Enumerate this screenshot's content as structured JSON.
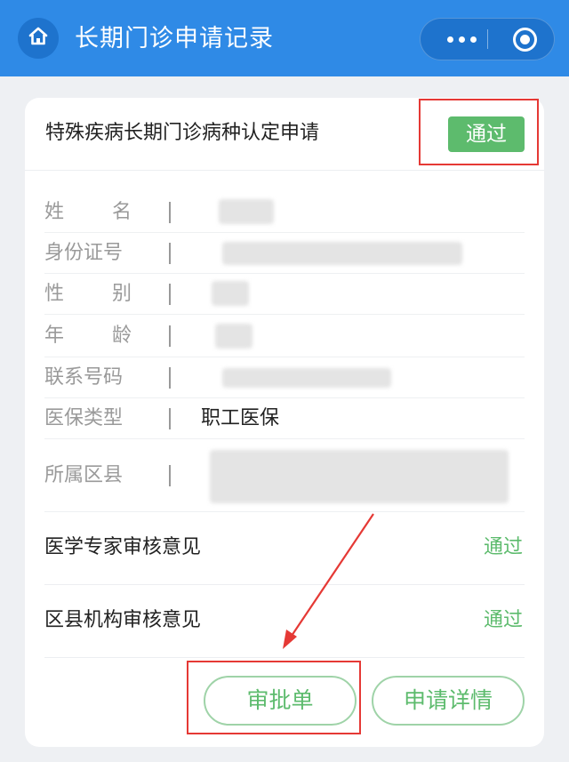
{
  "header": {
    "title": "长期门诊申请记录",
    "bg_color": "#2f8ae6"
  },
  "application": {
    "title": "特殊疾病长期门诊病种认定申请",
    "status": "通过",
    "status_color": "#5dbb6d"
  },
  "info": [
    {
      "label_chars": [
        "姓",
        "名"
      ],
      "value": ""
    },
    {
      "label": "身份证号",
      "value": ""
    },
    {
      "label_chars": [
        "性",
        "别"
      ],
      "value": ""
    },
    {
      "label_chars": [
        "年",
        "龄"
      ],
      "value": ""
    },
    {
      "label": "联系号码",
      "value": ""
    },
    {
      "label": "医保类型",
      "value": "职工医保"
    },
    {
      "label": "所属区县",
      "value": ""
    }
  ],
  "opinions": [
    {
      "label": "医学专家审核意见",
      "value": "通过"
    },
    {
      "label": "区县机构审核意见",
      "value": "通过"
    }
  ],
  "buttons": {
    "approval": "审批单",
    "details": "申请详情"
  },
  "annotation_color": "#e53935"
}
